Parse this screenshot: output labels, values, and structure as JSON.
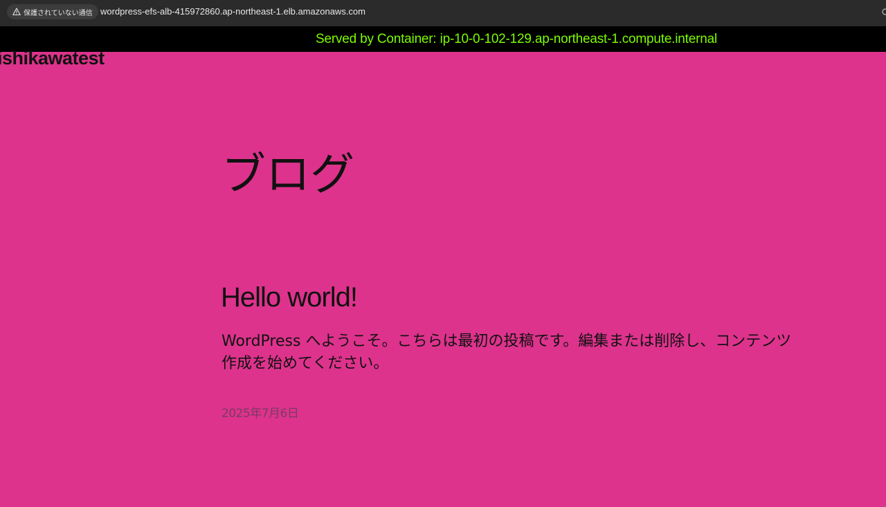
{
  "browser": {
    "security_label": "保護されていない通信",
    "url": "wordpress-efs-alb-415972860.ap-northeast-1.elb.amazonaws.com"
  },
  "banner": {
    "text": "Served by Container: ip-10-0-102-129.ap-northeast-1.compute.internal",
    "text_color": "#7cfc00",
    "background": "#000000"
  },
  "site": {
    "title": "ishikawatest",
    "background": "#dd338c"
  },
  "page": {
    "title": "ブログ"
  },
  "post": {
    "title": "Hello world!",
    "excerpt": "WordPress へようこそ。こちらは最初の投稿です。編集または削除し、コンテンツ作成を始めてください。",
    "date": "2025年7月6日"
  }
}
